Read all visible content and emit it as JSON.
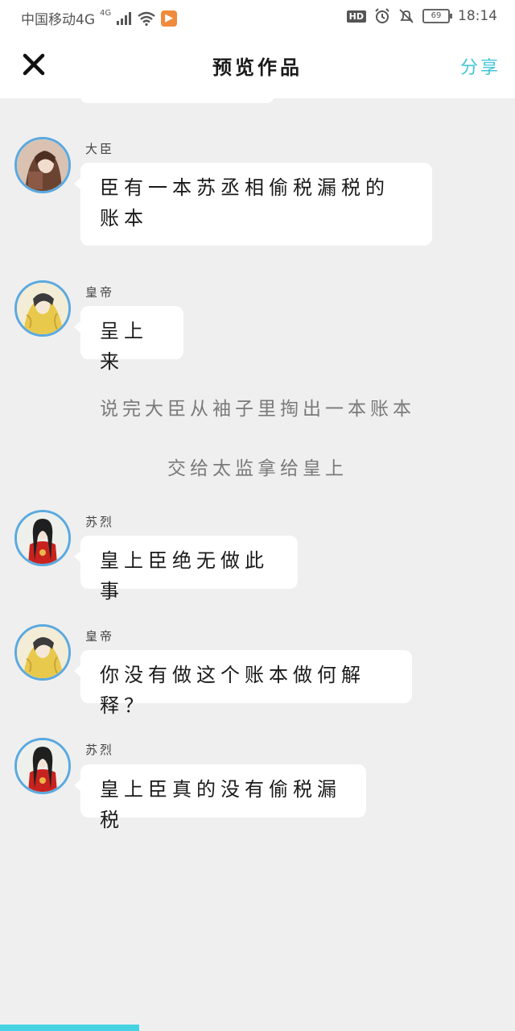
{
  "status_bar": {
    "carrier": "中国移动4G",
    "network_badge": "4G",
    "battery": "69",
    "time": "18:14"
  },
  "header": {
    "title": "预览作品",
    "share_label": "分享"
  },
  "messages": [
    {
      "sender": "大臣",
      "text": "臣有一本苏丞相偷税漏税的账本",
      "avatar": "minister-avatar"
    },
    {
      "sender": "皇帝",
      "text": "呈上来",
      "avatar": "emperor-avatar"
    },
    {
      "sender": "苏烈",
      "text": "皇上臣绝无做此事",
      "avatar": "sulie-avatar"
    },
    {
      "sender": "皇帝",
      "text": "你没有做这个账本做何解释？",
      "avatar": "emperor-avatar"
    },
    {
      "sender": "苏烈",
      "text": "皇上臣真的没有偷税漏税",
      "avatar": "sulie-avatar"
    }
  ],
  "narrations": [
    "说完大臣从袖子里掏出一本账本",
    "交给太监拿给皇上"
  ],
  "progress": 0.27,
  "colors": {
    "accent": "#43c6d9",
    "avatar_ring": "#5aa9e0",
    "background": "#efefef",
    "progress": "#45d3e3"
  }
}
